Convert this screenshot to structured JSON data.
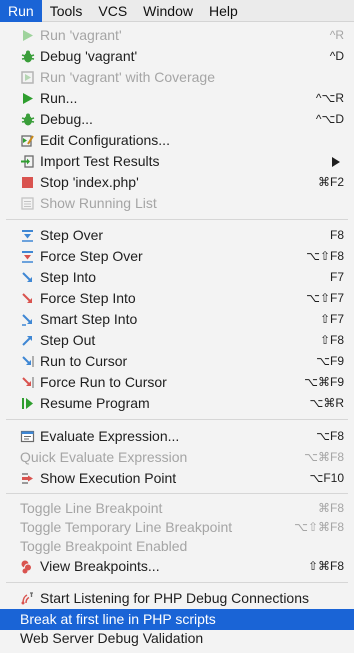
{
  "menubar": {
    "items": [
      "Run",
      "Tools",
      "VCS",
      "Window",
      "Help"
    ]
  },
  "menu": {
    "items": [
      {
        "label": "Run 'vagrant'",
        "shortcut": "^R",
        "icon": "run-icon"
      },
      {
        "label": "Debug 'vagrant'",
        "shortcut": "^D",
        "icon": "debug-icon"
      },
      {
        "label": "Run 'vagrant' with Coverage",
        "shortcut": "",
        "icon": "coverage-icon"
      },
      {
        "label": "Run...",
        "shortcut": "^⌥R",
        "icon": "run-icon"
      },
      {
        "label": "Debug...",
        "shortcut": "^⌥D",
        "icon": "debug-icon"
      },
      {
        "label": "Edit Configurations...",
        "shortcut": "",
        "icon": "edit-configurations-icon"
      },
      {
        "label": "Import Test Results",
        "shortcut": "",
        "icon": "import-icon"
      },
      {
        "label": "Stop 'index.php'",
        "shortcut": "⌘F2",
        "icon": "stop-icon"
      },
      {
        "label": "Show Running List",
        "shortcut": "",
        "icon": "list-icon"
      },
      {
        "label": "Step Over",
        "shortcut": "F8",
        "icon": "step-over-icon"
      },
      {
        "label": "Force Step Over",
        "shortcut": "⌥⇧F8",
        "icon": "force-step-over-icon"
      },
      {
        "label": "Step Into",
        "shortcut": "F7",
        "icon": "step-into-icon"
      },
      {
        "label": "Force Step Into",
        "shortcut": "⌥⇧F7",
        "icon": "force-step-into-icon"
      },
      {
        "label": "Smart Step Into",
        "shortcut": "⇧F7",
        "icon": "smart-step-into-icon"
      },
      {
        "label": "Step Out",
        "shortcut": "⇧F8",
        "icon": "step-out-icon"
      },
      {
        "label": "Run to Cursor",
        "shortcut": "⌥F9",
        "icon": "run-to-cursor-icon"
      },
      {
        "label": "Force Run to Cursor",
        "shortcut": "⌥⌘F9",
        "icon": "force-run-to-cursor-icon"
      },
      {
        "label": "Resume Program",
        "shortcut": "⌥⌘R",
        "icon": "resume-icon"
      },
      {
        "label": "Evaluate Expression...",
        "shortcut": "⌥F8",
        "icon": "evaluate-icon"
      },
      {
        "label": "Quick Evaluate Expression",
        "shortcut": "⌥⌘F8",
        "icon": ""
      },
      {
        "label": "Show Execution Point",
        "shortcut": "⌥F10",
        "icon": "execution-point-icon"
      },
      {
        "label": "Toggle Line Breakpoint",
        "shortcut": "⌘F8",
        "icon": ""
      },
      {
        "label": "Toggle Temporary Line Breakpoint",
        "shortcut": "⌥⇧⌘F8",
        "icon": ""
      },
      {
        "label": "Toggle Breakpoint Enabled",
        "shortcut": "",
        "icon": ""
      },
      {
        "label": "View Breakpoints...",
        "shortcut": "⇧⌘F8",
        "icon": "breakpoints-icon"
      },
      {
        "label": "Start Listening for PHP Debug Connections",
        "shortcut": "",
        "icon": "listen-icon"
      },
      {
        "label": "Break at first line in PHP scripts",
        "shortcut": "",
        "icon": ""
      },
      {
        "label": "Web Server Debug Validation",
        "shortcut": "",
        "icon": ""
      }
    ]
  },
  "colors": {
    "accent": "#1a64d6",
    "menu_bg": "#f3f3f3",
    "disabled_text": "#a5a5a5"
  }
}
